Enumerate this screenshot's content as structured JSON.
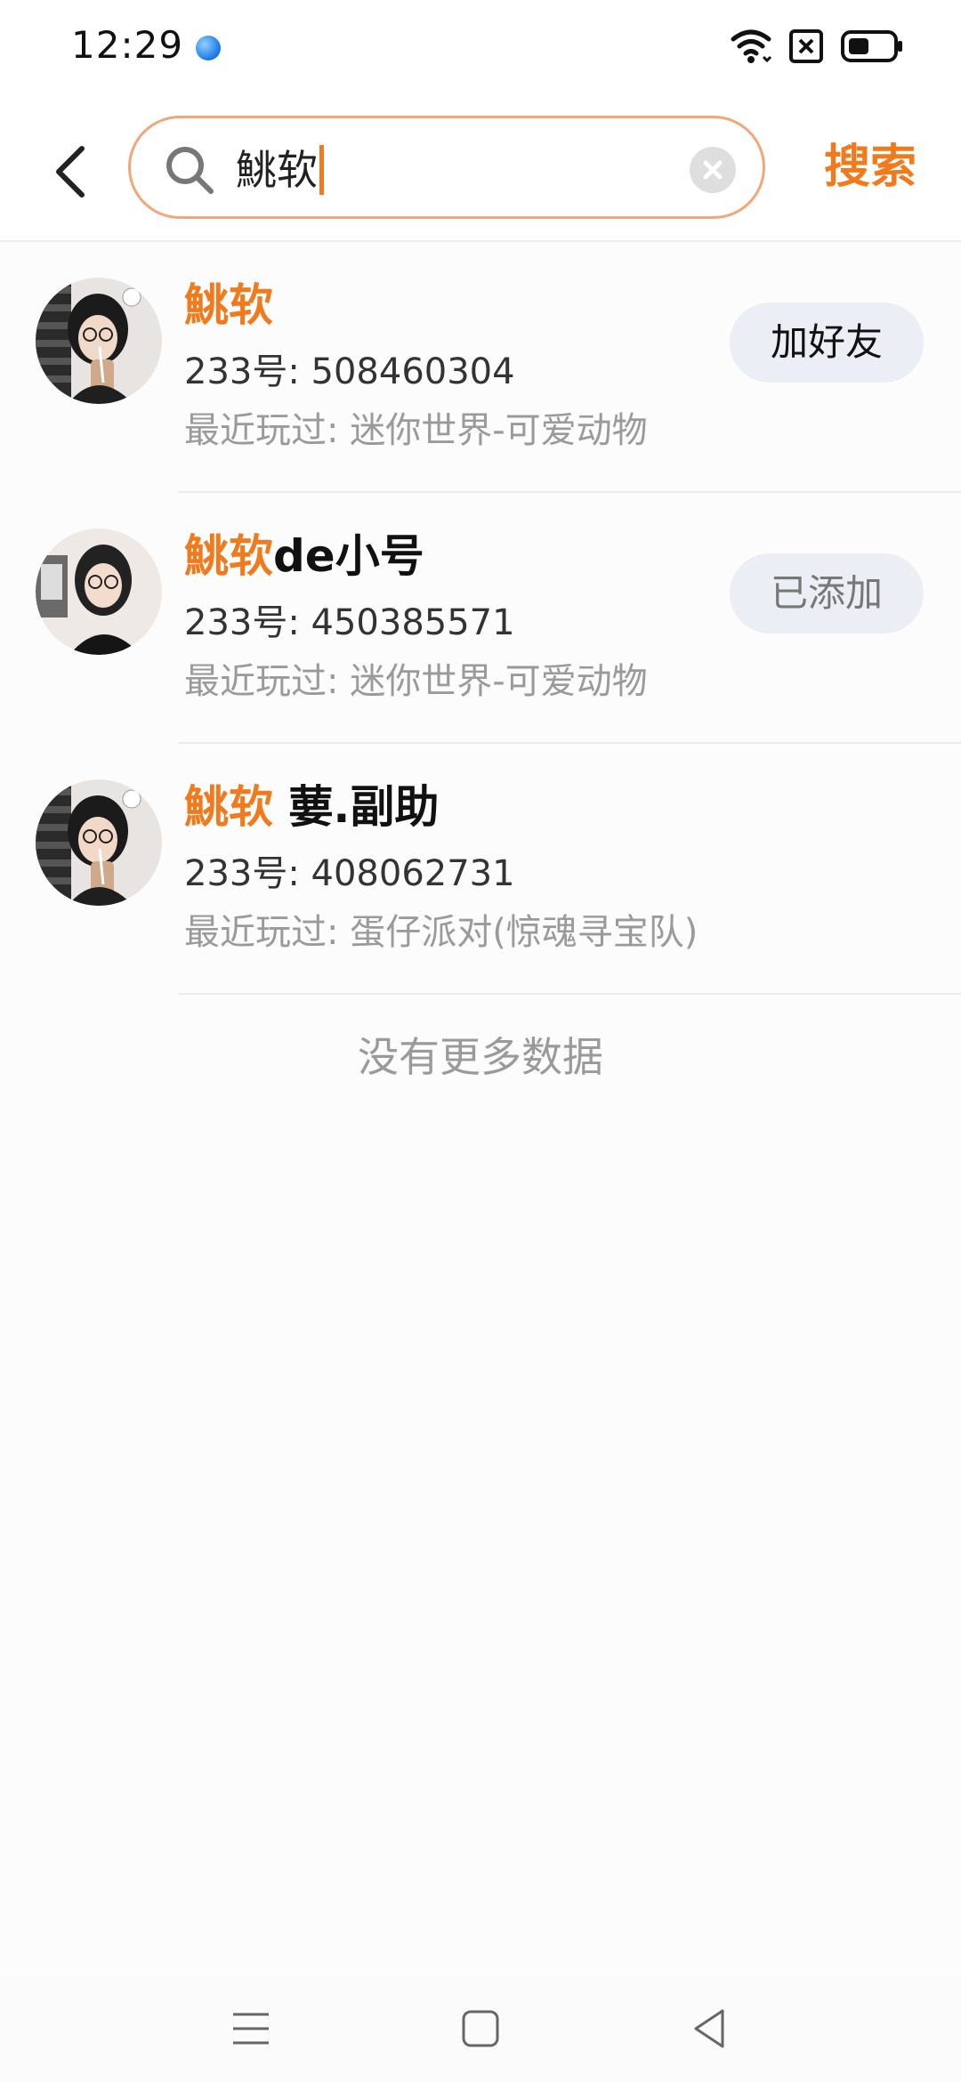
{
  "status_bar": {
    "time": "12:29"
  },
  "header": {
    "search_query": "鮡软",
    "search_button_label": "搜索"
  },
  "results": [
    {
      "name_highlight": "鮡软",
      "name_rest": "",
      "uid": "233号: 508460304",
      "recent": "最近玩过: 迷你世界-可爱动物",
      "action": "加好友",
      "action_state": "add"
    },
    {
      "name_highlight": "鮡软",
      "name_rest": "de小号",
      "uid": "233号: 450385571",
      "recent": "最近玩过: 迷你世界-可爱动物",
      "action": "已添加",
      "action_state": "added"
    },
    {
      "name_highlight": "鮡软",
      "name_rest": " 葽.副助",
      "uid": "233号: 408062731",
      "recent": "最近玩过: 蛋仔派对(惊魂寻宝队)",
      "action": "",
      "action_state": "none"
    }
  ],
  "footer_text": "没有更多数据",
  "colors": {
    "accent": "#f07a1c",
    "search_border": "#f2a679",
    "button_bg": "#eceef5"
  },
  "icons": [
    "back-arrow-icon",
    "search-icon",
    "clear-icon",
    "menu-icon",
    "home-icon",
    "back-triangle-icon",
    "wifi-icon",
    "sim-off-icon",
    "battery-icon"
  ]
}
